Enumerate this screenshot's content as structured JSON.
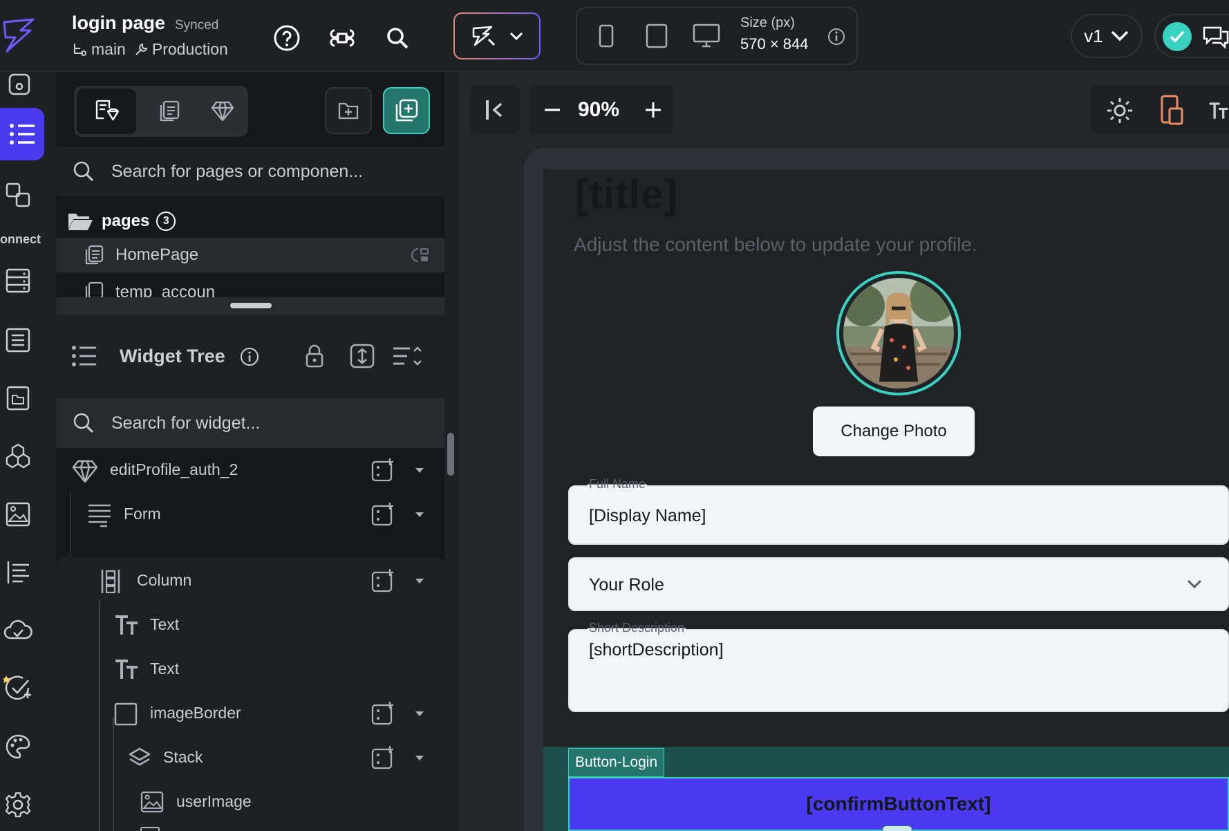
{
  "project": {
    "title": "login page",
    "sync_status": "Synced",
    "branch": "main",
    "environment": "Production"
  },
  "device": {
    "size_label": "Size (px)",
    "size_value": "570 × 844"
  },
  "version": "v1",
  "zoom": "90%",
  "left_rail": {
    "connect_label": "onnect"
  },
  "page_selector": {
    "search_placeholder": "Search for pages or componen...",
    "folder_name": "pages",
    "folder_count": "3",
    "pages": [
      {
        "name": "HomePage"
      },
      {
        "name": "temp_accoun"
      }
    ]
  },
  "widget_tree": {
    "title": "Widget Tree",
    "search_placeholder": "Search for widget...",
    "nodes": [
      {
        "label": "editProfile_auth_2",
        "icon": "gem-icon"
      },
      {
        "label": "Form",
        "icon": "form-icon"
      },
      {
        "label": "Column",
        "icon": "column-icon"
      },
      {
        "label": "Text",
        "icon": "text-icon"
      },
      {
        "label": "Text",
        "icon": "text-icon"
      },
      {
        "label": "imageBorder",
        "icon": "container-icon"
      },
      {
        "label": "Stack",
        "icon": "stack-icon"
      },
      {
        "label": "userImage",
        "icon": "image-icon"
      }
    ]
  },
  "preview": {
    "title": "[title]",
    "subtitle": "Adjust the content below to update your profile.",
    "change_photo": "Change Photo",
    "full_name_label": "Full Name",
    "full_name_value": "[Display Name]",
    "role_value": "Your Role",
    "short_desc_label": "Short Description",
    "short_desc_value": "[shortDescription]",
    "selected_widget_tag": "Button-Login",
    "confirm_button": "[confirmButtonText]"
  },
  "colors": {
    "accent": "#4b39ef",
    "teal": "#39d2c0",
    "orange": "#ee8b60"
  }
}
